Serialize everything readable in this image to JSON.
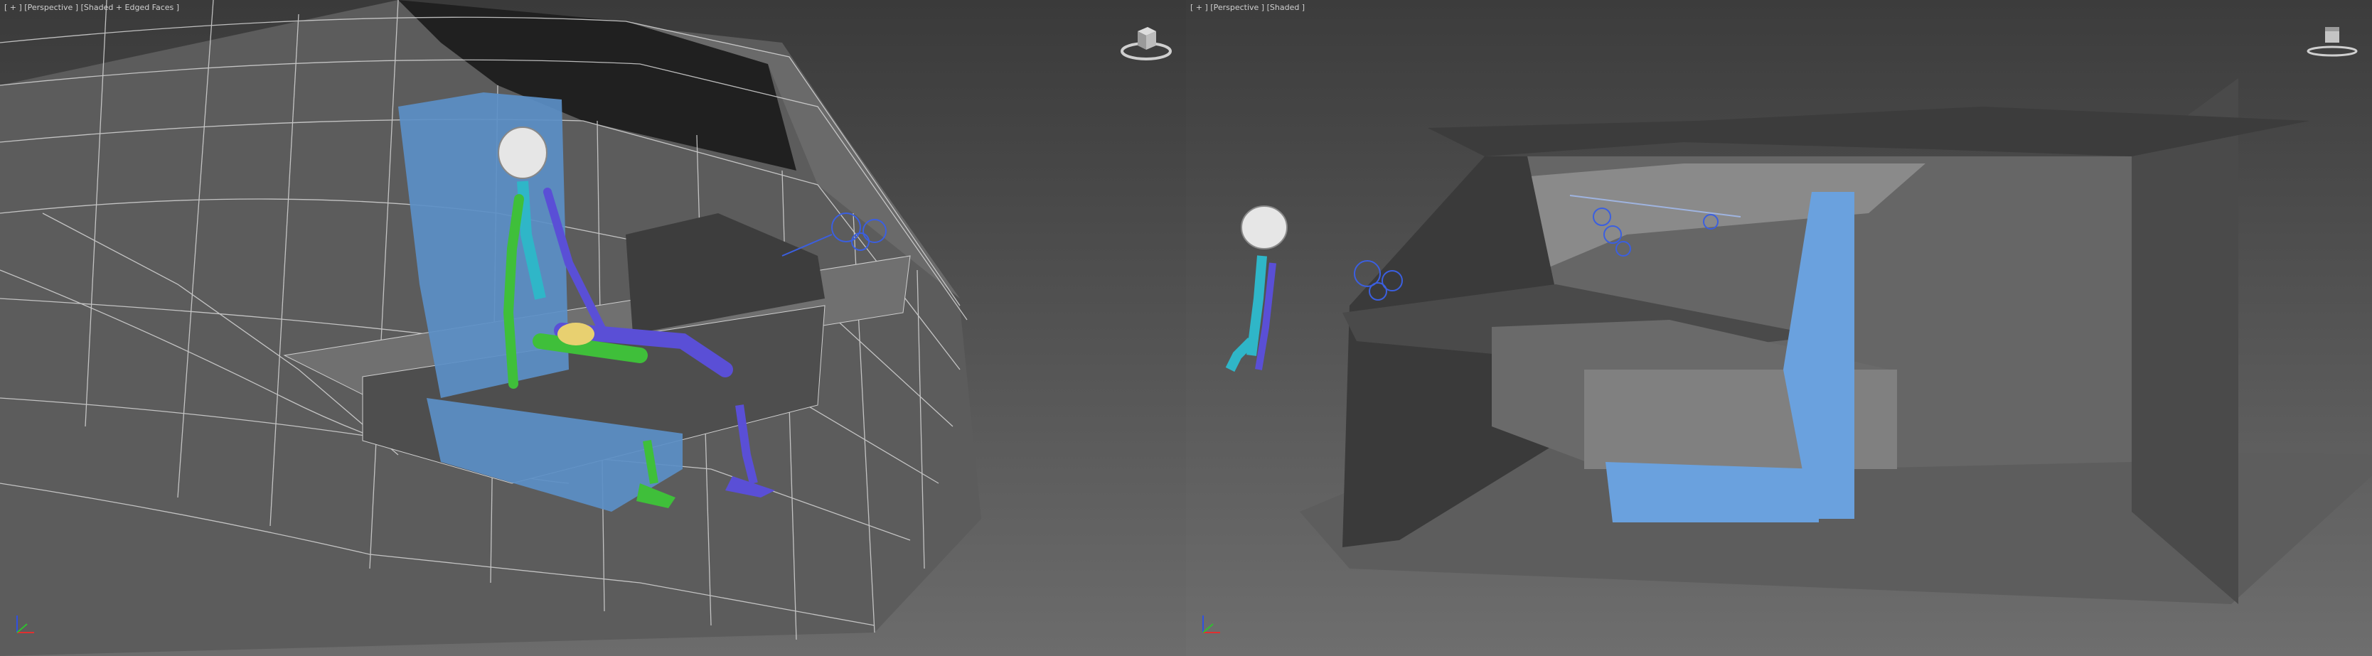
{
  "viewports": {
    "left": {
      "label_plus": "[ + ]",
      "label_view": "[Perspective ]",
      "label_shading": "[Shaded + Edged Faces ]",
      "shading_mode": "shaded-edged-faces"
    },
    "right": {
      "label_plus": "[ + ]",
      "label_view": "[Perspective ]",
      "label_shading": "[Shaded ]",
      "shading_mode": "shaded"
    }
  },
  "icons": {
    "viewcube": "viewcube-icon",
    "axis": "axis-tripod-icon"
  },
  "colors": {
    "seat_blue": "#5b8fc7",
    "skeleton_green": "#3fbf3a",
    "skeleton_purple": "#5a4fd6",
    "skeleton_cyan": "#2fb6c8",
    "pelvis_yellow": "#e8d070",
    "head_white": "#e6e6e6",
    "wire_white": "#d8d8d8",
    "body_grey": "#5a5a5a",
    "axis_x": "#e03030",
    "axis_y": "#30c030",
    "axis_z": "#3050e0"
  }
}
